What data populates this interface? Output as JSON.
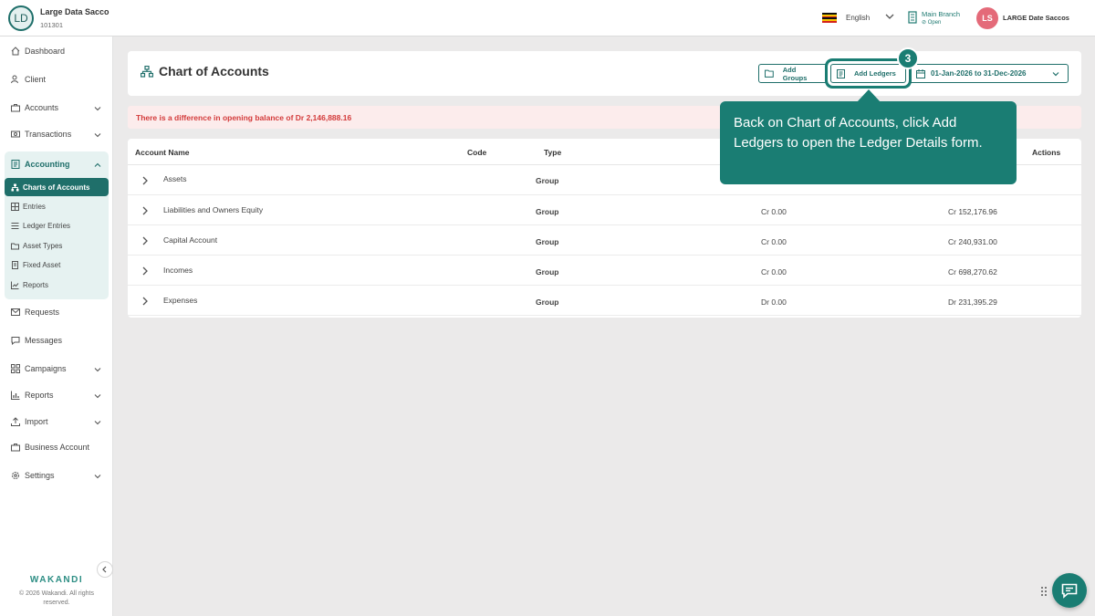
{
  "org": {
    "initials": "LD",
    "name": "Large Data Sacco",
    "code": "101301"
  },
  "topbar": {
    "language": "English",
    "branch_name": "Main Branch",
    "branch_status": "Open",
    "user_initials": "LS",
    "user_name": "LARGE Date Saccos"
  },
  "sidebar": {
    "dashboard": "Dashboard",
    "client": "Client",
    "accounts": "Accounts",
    "transactions": "Transactions",
    "accounting": "Accounting",
    "accounting_items": [
      "Charts of Accounts",
      "Entries",
      "Ledger Entries",
      "Asset Types",
      "Fixed Asset",
      "Reports"
    ],
    "requests": "Requests",
    "messages": "Messages",
    "campaigns": "Campaigns",
    "reports": "Reports",
    "import": "Import",
    "business_account": "Business Account",
    "settings": "Settings",
    "brand": "WAKANDI",
    "copyright": "© 2026 Wakandi. All rights reserved."
  },
  "page": {
    "title": "Chart of Accounts",
    "add_groups": "Add Groups",
    "add_ledgers": "Add Ledgers",
    "date_range": "01-Jan-2026 to 31-Dec-2026"
  },
  "warning": "There is a difference in opening balance of Dr 2,146,888.16",
  "table": {
    "headers": {
      "name": "Account Name",
      "code": "Code",
      "type": "Type",
      "actions": "Actions"
    },
    "rows": [
      {
        "name": "Assets",
        "type": "Group",
        "opening": "",
        "closing": ""
      },
      {
        "name": "Liabilities and Owners Equity",
        "type": "Group",
        "opening": "Cr 0.00",
        "closing": "Cr 152,176.96"
      },
      {
        "name": "Capital Account",
        "type": "Group",
        "opening": "Cr 0.00",
        "closing": "Cr 240,931.00"
      },
      {
        "name": "Incomes",
        "type": "Group",
        "opening": "Cr 0.00",
        "closing": "Cr 698,270.62"
      },
      {
        "name": "Expenses",
        "type": "Group",
        "opening": "Dr 0.00",
        "closing": "Dr 231,395.29"
      }
    ]
  },
  "tour": {
    "step": "3",
    "text": "Back on Chart of Accounts, click Add Ledgers to open the Ledger Details form."
  },
  "colors": {
    "primary": "#1f6f6a",
    "tour": "#1a7d73",
    "warning": "#d33a3a",
    "avatar": "#e46a79"
  }
}
